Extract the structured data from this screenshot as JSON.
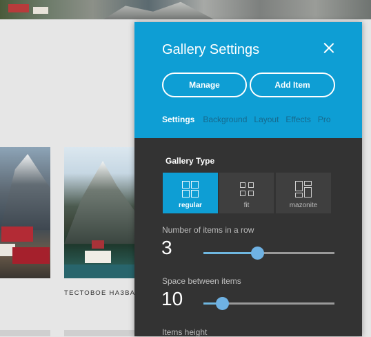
{
  "page": {
    "card_caption": "ТЕСТОВОЕ НАЗВАНИЕ"
  },
  "panel": {
    "title": "Gallery Settings",
    "manage_label": "Manage",
    "add_item_label": "Add Item",
    "tabs": [
      {
        "label": "Settings",
        "active": true
      },
      {
        "label": "Background"
      },
      {
        "label": "Layout"
      },
      {
        "label": "Effects"
      },
      {
        "label": "Pro"
      }
    ],
    "gallery_type": {
      "label": "Gallery Type",
      "options": [
        {
          "label": "regular",
          "icon": "grid-2x2-icon",
          "selected": true
        },
        {
          "label": "fit",
          "icon": "grid-fit-icon"
        },
        {
          "label": "mazonite",
          "icon": "masonry-icon"
        }
      ]
    },
    "items_in_row": {
      "label": "Number of items in a row",
      "value": "3",
      "fraction": 0.41
    },
    "space_between": {
      "label": "Space between items",
      "value": "10",
      "fraction": 0.14
    },
    "items_height": {
      "label": "Items height"
    }
  },
  "colors": {
    "accent": "#0e9ed4",
    "panel_body": "#333333"
  }
}
